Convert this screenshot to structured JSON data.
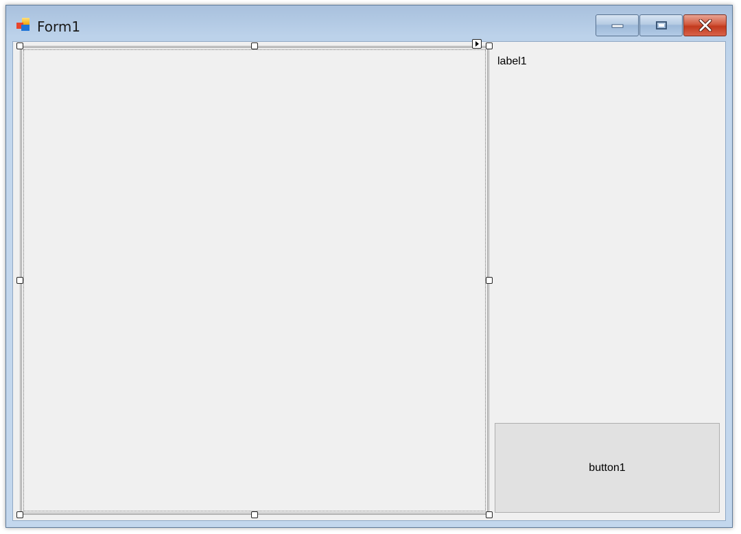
{
  "window": {
    "title": "Form1",
    "app_icon": "winforms-app-icon",
    "controls": {
      "minimize_icon": "minimize-icon",
      "maximize_icon": "maximize-icon",
      "close_icon": "close-icon"
    },
    "colors": {
      "close_button": "#c9432a",
      "frame": "#b9d1ea",
      "client_background": "#f0f0f0"
    }
  },
  "form": {
    "label1": "label1",
    "button1": "button1",
    "selected_panel": {
      "smart_tag_icon": "smart-tag-arrow-icon",
      "resize_handles": 8
    }
  }
}
